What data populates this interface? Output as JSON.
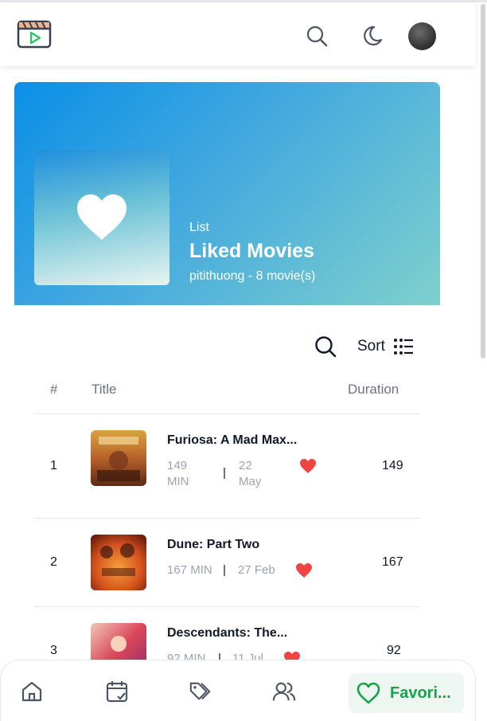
{
  "header": {
    "logo_icon": "clapperboard-play-icon",
    "search_icon": "search-icon",
    "theme_icon": "moon-icon",
    "avatar_icon": "user-avatar"
  },
  "hero": {
    "type_label": "List",
    "title": "Liked Movies",
    "subtitle": "pitithuong - 8 movie(s)",
    "cover_icon": "heart-icon"
  },
  "toolbar": {
    "search_icon": "search-icon",
    "sort_label": "Sort",
    "sort_icon": "list-icon"
  },
  "table": {
    "columns": [
      "#",
      "Title",
      "Duration"
    ],
    "rows": [
      {
        "num": "1",
        "title": "Furiosa: A Mad Max...",
        "min_value": "149",
        "min_unit": "MIN",
        "day": "22",
        "month": "May",
        "duration": "149"
      },
      {
        "num": "2",
        "title": "Dune: Part Two",
        "min_text": "167 MIN",
        "date_text": "27 Feb",
        "duration": "167"
      },
      {
        "num": "3",
        "title": "Descendants: The...",
        "min_text": "92 MIN",
        "date_text": "11 Jul",
        "duration": "92"
      }
    ]
  },
  "bottom_nav": {
    "items": [
      "home-icon",
      "calendar-check-icon",
      "tags-icon",
      "users-icon"
    ],
    "favorites_label": "Favori...",
    "favorites_icon": "heart-icon"
  },
  "colors": {
    "accent_green": "#16a34a",
    "heart_red": "#ef4444",
    "hero_start": "#0a8fe6",
    "hero_end": "#7fd0cc"
  }
}
